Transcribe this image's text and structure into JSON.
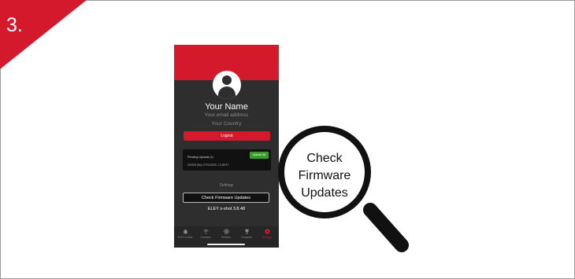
{
  "step": {
    "number": "3."
  },
  "profile": {
    "name": "Your Name",
    "email": "Your email address",
    "country": "Your Country",
    "logout_label": "Logout"
  },
  "uploads": {
    "pending_label": "Pending Uploads (1)",
    "upload_all_label": "Upload All",
    "row_text": "3/3/200 (Br)• 27/01/2020, 12:28:37"
  },
  "settings": {
    "section_label": "Settings",
    "check_firmware_label": "Check Firmware Updates",
    "version": "ELEY s-shot 3.8.48"
  },
  "tabs": [
    {
      "label": "ELEY s-shot",
      "icon": "home-icon"
    },
    {
      "label": "Connect",
      "icon": "wifi-icon"
    },
    {
      "label": "Session",
      "icon": "target-icon"
    },
    {
      "label": "Compete",
      "icon": "trophy-icon"
    },
    {
      "label": "Settings",
      "icon": "settings-icon",
      "active": true
    }
  ],
  "callout": {
    "line1": "Check",
    "line2": "Firmware",
    "line3": "Updates"
  },
  "colors": {
    "accent": "#d5192d",
    "phone_bg": "#2e2e2e",
    "upload_green": "#3a9b2a"
  }
}
